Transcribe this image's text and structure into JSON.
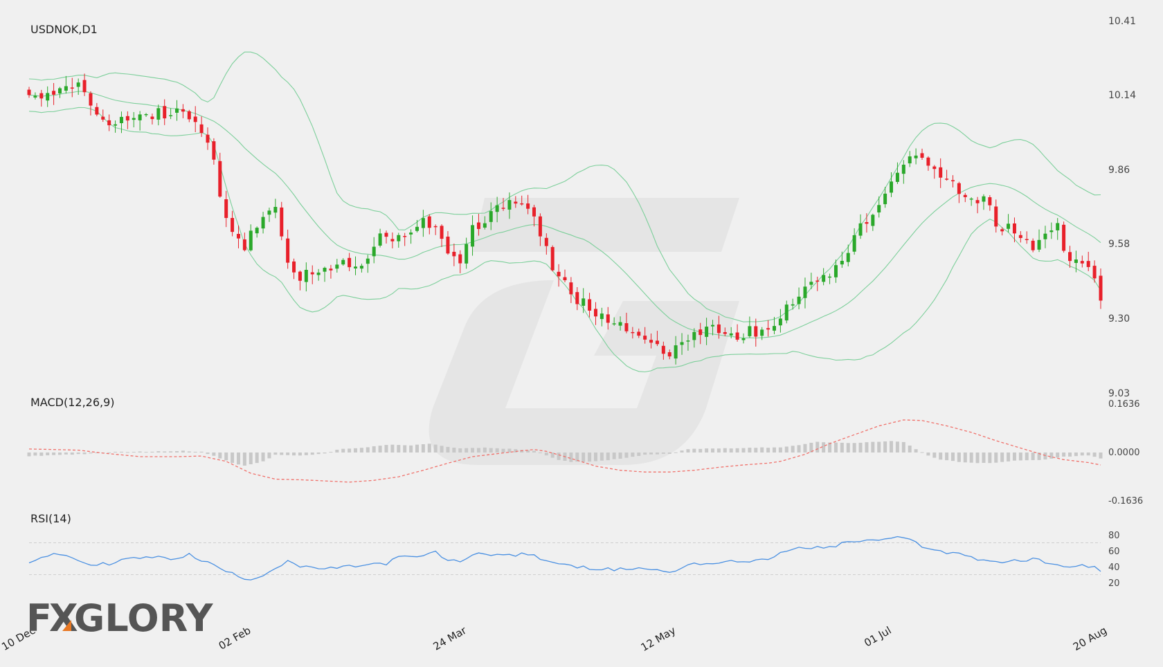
{
  "chart_data": [
    {
      "type": "candlestick",
      "title": "USDNOK,D1",
      "y_ticks": [
        "10.41",
        "10.14",
        "9.86",
        "9.58",
        "9.30",
        "9.03"
      ],
      "ylim": [
        9.03,
        10.41
      ],
      "x_ticks": [
        "10 Dec",
        "02 Feb",
        "24 Mar",
        "12 May",
        "01 Jul",
        "20 Aug"
      ],
      "x_tick_bar_index": [
        0,
        35,
        70,
        104,
        139,
        174
      ],
      "num_bars": 175,
      "overlay": "Bollinger Bands",
      "up_color": "#2aa82a",
      "down_color": "#e8202a",
      "band_color": "#7ccf9a",
      "close_keypoints": [
        [
          0,
          10.12
        ],
        [
          5,
          10.16
        ],
        [
          8,
          10.18
        ],
        [
          10,
          10.1
        ],
        [
          12,
          10.02
        ],
        [
          14,
          10.04
        ],
        [
          18,
          10.06
        ],
        [
          22,
          10.07
        ],
        [
          25,
          10.08
        ],
        [
          27,
          10.02
        ],
        [
          29,
          9.97
        ],
        [
          31,
          9.78
        ],
        [
          33,
          9.62
        ],
        [
          35,
          9.58
        ],
        [
          38,
          9.68
        ],
        [
          40,
          9.72
        ],
        [
          42,
          9.5
        ],
        [
          44,
          9.46
        ],
        [
          48,
          9.48
        ],
        [
          51,
          9.52
        ],
        [
          54,
          9.5
        ],
        [
          56,
          9.58
        ],
        [
          58,
          9.62
        ],
        [
          60,
          9.6
        ],
        [
          62,
          9.62
        ],
        [
          64,
          9.68
        ],
        [
          66,
          9.64
        ],
        [
          68,
          9.56
        ],
        [
          70,
          9.52
        ],
        [
          72,
          9.64
        ],
        [
          74,
          9.68
        ],
        [
          76,
          9.72
        ],
        [
          78,
          9.73
        ],
        [
          80,
          9.74
        ],
        [
          82,
          9.69
        ],
        [
          84,
          9.55
        ],
        [
          86,
          9.46
        ],
        [
          88,
          9.4
        ],
        [
          90,
          9.36
        ],
        [
          92,
          9.32
        ],
        [
          94,
          9.3
        ],
        [
          96,
          9.28
        ],
        [
          98,
          9.25
        ],
        [
          100,
          9.24
        ],
        [
          102,
          9.2
        ],
        [
          104,
          9.18
        ],
        [
          106,
          9.22
        ],
        [
          108,
          9.26
        ],
        [
          110,
          9.27
        ],
        [
          112,
          9.25
        ],
        [
          115,
          9.24
        ],
        [
          118,
          9.26
        ],
        [
          120,
          9.27
        ],
        [
          122,
          9.31
        ],
        [
          124,
          9.36
        ],
        [
          125,
          9.4
        ],
        [
          127,
          9.45
        ],
        [
          130,
          9.48
        ],
        [
          132,
          9.52
        ],
        [
          134,
          9.62
        ],
        [
          136,
          9.66
        ],
        [
          138,
          9.72
        ],
        [
          139,
          9.78
        ],
        [
          141,
          9.84
        ],
        [
          143,
          9.92
        ],
        [
          145,
          9.9
        ],
        [
          147,
          9.86
        ],
        [
          149,
          9.82
        ],
        [
          151,
          9.77
        ],
        [
          153,
          9.74
        ],
        [
          155,
          9.76
        ],
        [
          157,
          9.66
        ],
        [
          159,
          9.64
        ],
        [
          161,
          9.62
        ],
        [
          163,
          9.58
        ],
        [
          165,
          9.62
        ],
        [
          167,
          9.66
        ],
        [
          168,
          9.55
        ],
        [
          170,
          9.52
        ],
        [
          172,
          9.5
        ],
        [
          173,
          9.46
        ],
        [
          174,
          9.35
        ]
      ]
    },
    {
      "type": "bar+line",
      "title": "MACD(12,26,9)",
      "y_ticks": [
        "0.1636",
        "0.0000",
        "-0.1636"
      ],
      "ylim": [
        -0.1636,
        0.1636
      ],
      "histogram_color": "#c8c8c8",
      "signal_color": "#f0706a",
      "histogram_keypoints": [
        [
          0,
          -0.012
        ],
        [
          10,
          -0.004
        ],
        [
          14,
          0.002
        ],
        [
          20,
          0.003
        ],
        [
          25,
          0.006
        ],
        [
          28,
          0.002
        ],
        [
          30,
          -0.012
        ],
        [
          33,
          -0.035
        ],
        [
          35,
          -0.045
        ],
        [
          38,
          -0.03
        ],
        [
          40,
          -0.008
        ],
        [
          45,
          -0.01
        ],
        [
          48,
          -0.004
        ],
        [
          50,
          0.01
        ],
        [
          55,
          0.018
        ],
        [
          58,
          0.026
        ],
        [
          62,
          0.024
        ],
        [
          65,
          0.03
        ],
        [
          67,
          0.022
        ],
        [
          70,
          0.014
        ],
        [
          74,
          0.016
        ],
        [
          78,
          0.012
        ],
        [
          82,
          0.006
        ],
        [
          84,
          -0.01
        ],
        [
          86,
          -0.025
        ],
        [
          88,
          -0.032
        ],
        [
          92,
          -0.03
        ],
        [
          96,
          -0.02
        ],
        [
          98,
          -0.014
        ],
        [
          100,
          -0.008
        ],
        [
          104,
          -0.004
        ],
        [
          107,
          0.012
        ],
        [
          112,
          0.014
        ],
        [
          118,
          0.016
        ],
        [
          122,
          0.018
        ],
        [
          126,
          0.028
        ],
        [
          128,
          0.036
        ],
        [
          132,
          0.032
        ],
        [
          136,
          0.034
        ],
        [
          140,
          0.038
        ],
        [
          142,
          0.036
        ],
        [
          144,
          0.012
        ],
        [
          146,
          -0.01
        ],
        [
          148,
          -0.024
        ],
        [
          152,
          -0.034
        ],
        [
          155,
          -0.036
        ],
        [
          158,
          -0.032
        ],
        [
          161,
          -0.026
        ],
        [
          165,
          -0.024
        ],
        [
          168,
          -0.014
        ],
        [
          172,
          -0.01
        ],
        [
          174,
          -0.02
        ]
      ],
      "signal_keypoints": [
        [
          0,
          0.012
        ],
        [
          8,
          0.008
        ],
        [
          12,
          -0.002
        ],
        [
          18,
          -0.014
        ],
        [
          24,
          -0.014
        ],
        [
          28,
          -0.012
        ],
        [
          32,
          -0.03
        ],
        [
          36,
          -0.07
        ],
        [
          40,
          -0.09
        ],
        [
          44,
          -0.092
        ],
        [
          48,
          -0.096
        ],
        [
          52,
          -0.1
        ],
        [
          56,
          -0.094
        ],
        [
          60,
          -0.082
        ],
        [
          64,
          -0.06
        ],
        [
          68,
          -0.036
        ],
        [
          72,
          -0.014
        ],
        [
          76,
          -0.004
        ],
        [
          80,
          0.006
        ],
        [
          82,
          0.01
        ],
        [
          84,
          0.004
        ],
        [
          88,
          -0.02
        ],
        [
          92,
          -0.046
        ],
        [
          96,
          -0.06
        ],
        [
          100,
          -0.066
        ],
        [
          104,
          -0.066
        ],
        [
          108,
          -0.06
        ],
        [
          112,
          -0.05
        ],
        [
          116,
          -0.042
        ],
        [
          120,
          -0.036
        ],
        [
          122,
          -0.03
        ],
        [
          126,
          -0.006
        ],
        [
          130,
          0.03
        ],
        [
          134,
          0.06
        ],
        [
          138,
          0.09
        ],
        [
          142,
          0.11
        ],
        [
          145,
          0.108
        ],
        [
          149,
          0.09
        ],
        [
          153,
          0.068
        ],
        [
          157,
          0.04
        ],
        [
          161,
          0.015
        ],
        [
          165,
          -0.01
        ],
        [
          168,
          -0.024
        ],
        [
          172,
          -0.034
        ],
        [
          174,
          -0.042
        ]
      ]
    },
    {
      "type": "line",
      "title": "RSI(14)",
      "y_ticks": [
        "80",
        "60",
        "40",
        "20"
      ],
      "ylim": [
        20,
        80
      ],
      "levels": [
        70,
        30
      ],
      "line_color": "#4a90e2",
      "keypoints": [
        [
          0,
          46
        ],
        [
          2,
          52
        ],
        [
          5,
          56
        ],
        [
          8,
          48
        ],
        [
          10,
          42
        ],
        [
          13,
          44
        ],
        [
          16,
          50
        ],
        [
          20,
          52
        ],
        [
          23,
          50
        ],
        [
          26,
          55
        ],
        [
          28,
          48
        ],
        [
          30,
          42
        ],
        [
          32,
          34
        ],
        [
          34,
          28
        ],
        [
          36,
          24
        ],
        [
          38,
          30
        ],
        [
          40,
          38
        ],
        [
          42,
          48
        ],
        [
          44,
          40
        ],
        [
          46,
          38
        ],
        [
          50,
          38
        ],
        [
          54,
          42
        ],
        [
          58,
          44
        ],
        [
          60,
          52
        ],
        [
          63,
          52
        ],
        [
          66,
          58
        ],
        [
          68,
          48
        ],
        [
          70,
          46
        ],
        [
          72,
          56
        ],
        [
          75,
          56
        ],
        [
          78,
          54
        ],
        [
          81,
          56
        ],
        [
          84,
          48
        ],
        [
          86,
          44
        ],
        [
          88,
          40
        ],
        [
          92,
          38
        ],
        [
          95,
          36
        ],
        [
          98,
          38
        ],
        [
          100,
          38
        ],
        [
          103,
          34
        ],
        [
          105,
          34
        ],
        [
          107,
          44
        ],
        [
          110,
          44
        ],
        [
          114,
          46
        ],
        [
          118,
          48
        ],
        [
          121,
          52
        ],
        [
          123,
          60
        ],
        [
          126,
          64
        ],
        [
          129,
          64
        ],
        [
          131,
          66
        ],
        [
          133,
          72
        ],
        [
          136,
          72
        ],
        [
          138,
          74
        ],
        [
          141,
          76
        ],
        [
          143,
          74
        ],
        [
          145,
          66
        ],
        [
          147,
          62
        ],
        [
          149,
          56
        ],
        [
          151,
          58
        ],
        [
          153,
          52
        ],
        [
          155,
          48
        ],
        [
          158,
          46
        ],
        [
          162,
          48
        ],
        [
          164,
          50
        ],
        [
          166,
          42
        ],
        [
          168,
          40
        ],
        [
          170,
          42
        ],
        [
          173,
          40
        ],
        [
          174,
          34
        ]
      ]
    }
  ],
  "watermark": {
    "brand_text_left": "F",
    "brand_text_mid": "X",
    "brand_text_right": "GLORY",
    "accent_color": "#e87722"
  }
}
